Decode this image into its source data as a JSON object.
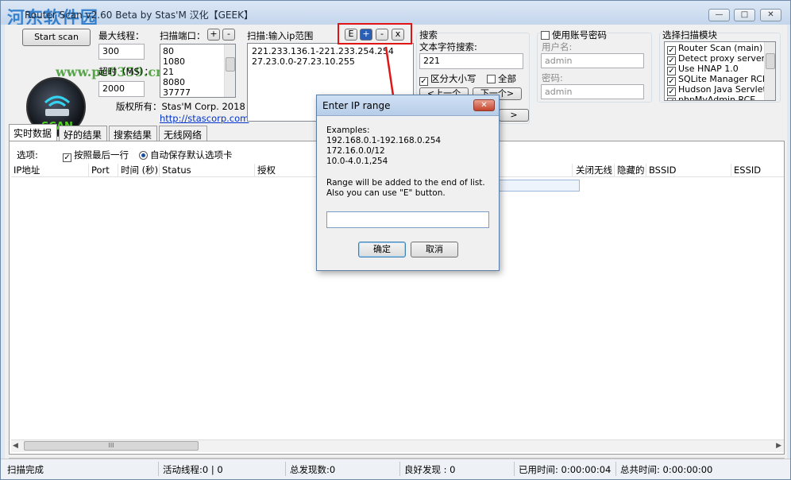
{
  "window": {
    "title": "Router Scan v2.60 Beta by Stas'M  汉化【GEEK】",
    "watermark_cn": "河东软件园",
    "watermark_url": "www.pc0359.cn",
    "controls": {
      "minimize": "—",
      "maximize": "□",
      "close": "✕"
    }
  },
  "toolbar": {
    "start_scan": "Start scan",
    "max_threads_label": "最大线程：",
    "max_threads_value": "300",
    "timeout_label": "超时（MS）：",
    "timeout_value": "2000",
    "copyright": "版权所有：Stas'M Corp. 2018",
    "link": "http://stascorp.com",
    "ports_label": "扫描端口：",
    "ports_add": "+",
    "ports_remove": "-",
    "ports": [
      "80",
      "1080",
      "21",
      "8080",
      "37777"
    ],
    "ranges_label": "扫描:输入ip范围",
    "range_buttons": [
      "E",
      "+",
      "-",
      "x"
    ],
    "ranges": [
      "221.233.136.1-221.233.254.254",
      "27.23.0.0-27.23.10.255"
    ]
  },
  "search": {
    "title": "搜索",
    "text_label": "文本字符搜索:",
    "value": "221",
    "case_label": "区分大小写",
    "case_checked": true,
    "all_label": "全部",
    "all_checked": false,
    "prev": "<上一个",
    "next": "下一个>"
  },
  "account": {
    "use_label": "使用账号密码",
    "checked": false,
    "user_label": "用户名:",
    "user_value": "admin",
    "pass_label": "密码:",
    "pass_value": "admin"
  },
  "modules": {
    "title": "选择扫描模块",
    "items": [
      "Router Scan (main)",
      "Detect proxy servers",
      "Use HNAP 1.0",
      "SQLite Manager RCE",
      "Hudson Java Servlet",
      "phpMyAdmin RCE"
    ]
  },
  "tabs": [
    "实时数据",
    "好的结果",
    "搜索结果",
    "无线网络"
  ],
  "options": {
    "label": "选项:",
    "follow_last": "按照最后一行",
    "auto_save": "自动保存默认选项卡"
  },
  "grid": {
    "columns": [
      "IP地址",
      "Port",
      "时间 (秒)",
      "Status",
      "授权",
      "关闭无线",
      "隐藏的",
      "BSSID",
      "ESSID"
    ],
    "hscroll_thumb": "III"
  },
  "status_bar": {
    "state": "扫描完成",
    "threads": "活动线程:0 | 0",
    "total": "总发现数:0",
    "good": "良好发现 : 0",
    "elapsed": "已用时间: 0:00:00:04",
    "total_time": "总共时间: 0:00:00:00"
  },
  "dialog": {
    "title": "Enter IP range",
    "close": "✕",
    "examples_label": "Examples:",
    "examples": [
      "192.168.0.1-192.168.0.254",
      "172.16.0.0/12",
      "10.0-4.0.1,254"
    ],
    "note1": "Range will be added to the end of list.",
    "note2": "Also you can use \"E\" button.",
    "input_value": "",
    "ok": "确定",
    "cancel": "取消"
  },
  "colors": {
    "accent": "#1b4f9c",
    "annotation_red": "#e01515"
  }
}
